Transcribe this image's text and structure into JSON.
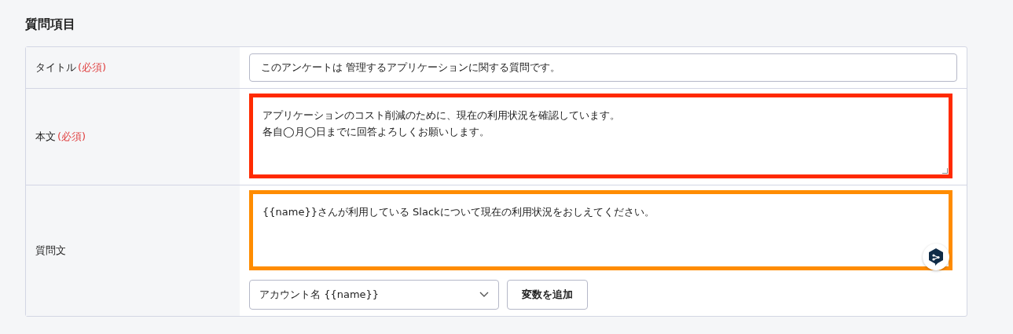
{
  "section_title": "質問項目",
  "rows": [
    {
      "kind": "input",
      "label": "タイトル",
      "required_mark": "(必須)",
      "value": "このアンケートは 管理するアプリケーションに関する質問です。"
    },
    {
      "kind": "textarea",
      "label": "本文",
      "required_mark": "(必須)",
      "lines": [
        "アプリケーションのコスト削減のために、現在の利用状況を確認しています。",
        "各自◯月◯日までに回答よろしくお願いします。"
      ],
      "color": "#ff2a00"
    },
    {
      "kind": "textarea",
      "label": "質問文",
      "lines": [
        "{{name}}さんが利用している Slackについて現在の利用状況をおしえてください。"
      ],
      "color": "#ff8c00",
      "assistant_badge": true,
      "variable_select": "アカウント名 {{name}}",
      "add_button": "変数を追加"
    }
  ]
}
